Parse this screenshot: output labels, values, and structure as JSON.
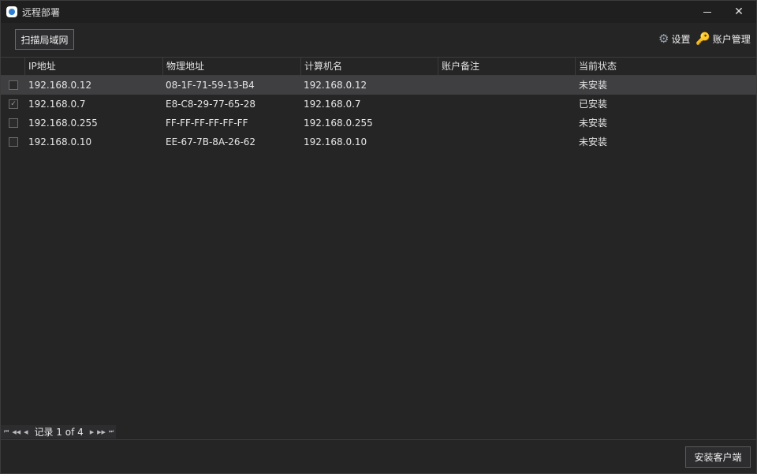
{
  "window": {
    "title": "远程部署"
  },
  "toolbar": {
    "scan_label": "扫描局域网",
    "settings_label": "设置",
    "accounts_label": "账户管理"
  },
  "grid": {
    "columns": [
      "IP地址",
      "物理地址",
      "计算机名",
      "账户备注",
      "当前状态"
    ],
    "rows": [
      {
        "checked": false,
        "ip": "192.168.0.12",
        "mac": "08-1F-71-59-13-B4",
        "name": "192.168.0.12",
        "note": "",
        "status": "未安装"
      },
      {
        "checked": true,
        "ip": "192.168.0.7",
        "mac": "E8-C8-29-77-65-28",
        "name": "192.168.0.7",
        "note": "",
        "status": "已安装"
      },
      {
        "checked": false,
        "ip": "192.168.0.255",
        "mac": "FF-FF-FF-FF-FF-FF",
        "name": "192.168.0.255",
        "note": "",
        "status": "未安装"
      },
      {
        "checked": false,
        "ip": "192.168.0.10",
        "mac": "EE-67-7B-8A-26-62",
        "name": "192.168.0.10",
        "note": "",
        "status": "未安装"
      }
    ]
  },
  "pager": {
    "text": "记录 1 of 4"
  },
  "footer": {
    "install_label": "安装客户端"
  },
  "icons": {
    "app": "app-icon",
    "settings": "gear-icon",
    "accounts": "key-icon"
  },
  "colors": {
    "background": "#252526",
    "accent": "#1e7fc9",
    "selected_row": "#3f3f41"
  }
}
